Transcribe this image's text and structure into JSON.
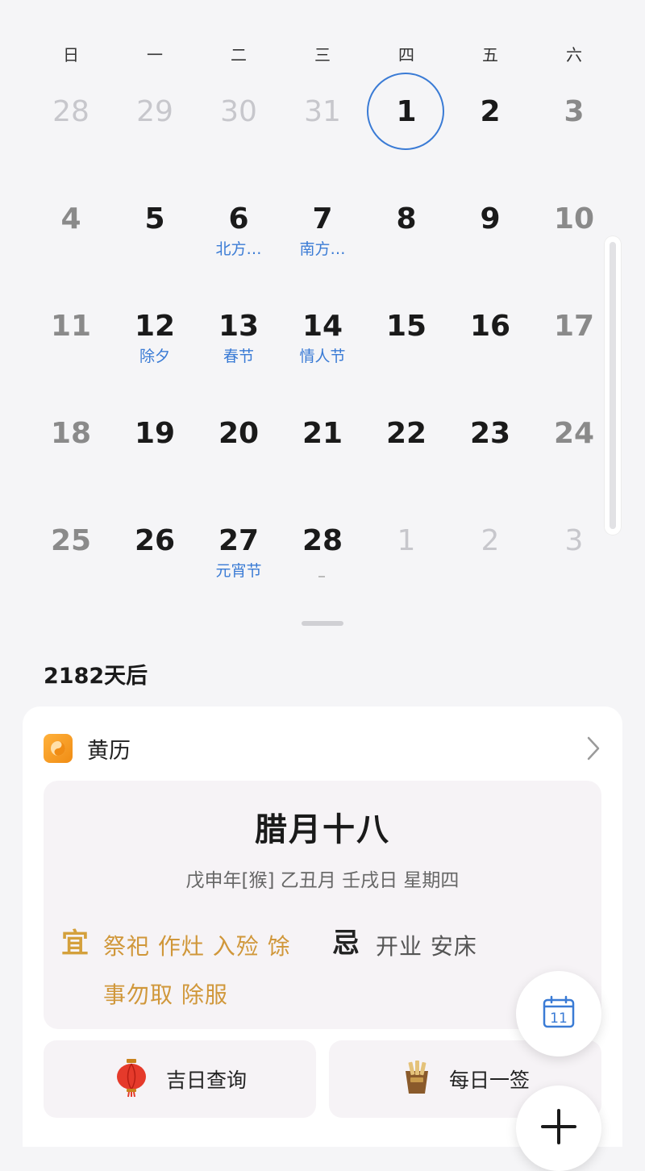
{
  "weekdays": [
    "日",
    "一",
    "二",
    "三",
    "四",
    "五",
    "六"
  ],
  "calendar": {
    "cells": [
      {
        "day": "28",
        "kind": "other",
        "sub": ""
      },
      {
        "day": "29",
        "kind": "other",
        "sub": ""
      },
      {
        "day": "30",
        "kind": "other",
        "sub": ""
      },
      {
        "day": "31",
        "kind": "other",
        "sub": ""
      },
      {
        "day": "1",
        "kind": "today",
        "sub": ""
      },
      {
        "day": "2",
        "kind": "normal",
        "sub": ""
      },
      {
        "day": "3",
        "kind": "weekend",
        "sub": ""
      },
      {
        "day": "4",
        "kind": "weekend",
        "sub": ""
      },
      {
        "day": "5",
        "kind": "normal",
        "sub": ""
      },
      {
        "day": "6",
        "kind": "normal",
        "sub": "北方…"
      },
      {
        "day": "7",
        "kind": "normal",
        "sub": "南方…"
      },
      {
        "day": "8",
        "kind": "normal",
        "sub": ""
      },
      {
        "day": "9",
        "kind": "normal",
        "sub": ""
      },
      {
        "day": "10",
        "kind": "weekend",
        "sub": ""
      },
      {
        "day": "11",
        "kind": "weekend",
        "sub": ""
      },
      {
        "day": "12",
        "kind": "normal",
        "sub": "除夕"
      },
      {
        "day": "13",
        "kind": "normal",
        "sub": "春节"
      },
      {
        "day": "14",
        "kind": "normal",
        "sub": "情人节"
      },
      {
        "day": "15",
        "kind": "normal",
        "sub": ""
      },
      {
        "day": "16",
        "kind": "normal",
        "sub": ""
      },
      {
        "day": "17",
        "kind": "weekend",
        "sub": ""
      },
      {
        "day": "18",
        "kind": "weekend",
        "sub": ""
      },
      {
        "day": "19",
        "kind": "normal",
        "sub": ""
      },
      {
        "day": "20",
        "kind": "normal",
        "sub": ""
      },
      {
        "day": "21",
        "kind": "normal",
        "sub": ""
      },
      {
        "day": "22",
        "kind": "normal",
        "sub": ""
      },
      {
        "day": "23",
        "kind": "normal",
        "sub": ""
      },
      {
        "day": "24",
        "kind": "weekend",
        "sub": ""
      },
      {
        "day": "25",
        "kind": "weekend",
        "sub": ""
      },
      {
        "day": "26",
        "kind": "normal",
        "sub": ""
      },
      {
        "day": "27",
        "kind": "normal",
        "sub": "元宵节"
      },
      {
        "day": "28",
        "kind": "normal",
        "sub": ""
      },
      {
        "day": "1",
        "kind": "other",
        "sub": ""
      },
      {
        "day": "2",
        "kind": "other",
        "sub": ""
      },
      {
        "day": "3",
        "kind": "other",
        "sub": ""
      }
    ]
  },
  "days_after": "2182天后",
  "almanac_card": {
    "title": "黄历",
    "lunar_date": "腊月十八",
    "ganzhi": "戊申年[猴]   乙丑月  壬戌日  星期四",
    "yi_label": "宜",
    "yi_items": "祭祀 作灶 入殓 馀事勿取 除服",
    "ji_label": "忌",
    "ji_items": "开业 安床",
    "btn_lucky": "吉日查询",
    "btn_daily": "每日一签"
  },
  "fab_calendar_day": "11",
  "colors": {
    "accent": "#3a7bd5",
    "yi": "#d0973a",
    "icon_orange": "#f39a1d"
  },
  "icons": [
    "app-almanac-icon",
    "chevron-right-icon",
    "lantern-icon",
    "fortune-sticks-icon",
    "calendar-icon",
    "plus-icon"
  ]
}
